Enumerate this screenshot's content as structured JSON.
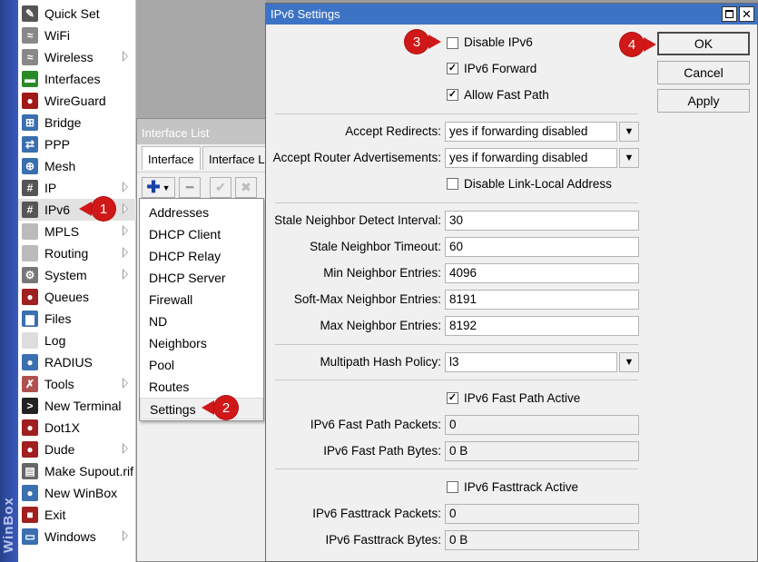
{
  "app_vertical_label": "WinBox",
  "sidebar": {
    "items": [
      {
        "label": "Quick Set",
        "icon": "quick-set-icon",
        "submenu": false
      },
      {
        "label": "WiFi",
        "icon": "wifi-icon",
        "submenu": false
      },
      {
        "label": "Wireless",
        "icon": "wireless-icon",
        "submenu": true
      },
      {
        "label": "Interfaces",
        "icon": "interfaces-icon",
        "submenu": false
      },
      {
        "label": "WireGuard",
        "icon": "wireguard-icon",
        "submenu": false
      },
      {
        "label": "Bridge",
        "icon": "bridge-icon",
        "submenu": false
      },
      {
        "label": "PPP",
        "icon": "ppp-icon",
        "submenu": false
      },
      {
        "label": "Mesh",
        "icon": "mesh-icon",
        "submenu": false
      },
      {
        "label": "IP",
        "icon": "ip-icon",
        "submenu": true
      },
      {
        "label": "IPv6",
        "icon": "ipv6-icon",
        "submenu": true
      },
      {
        "label": "MPLS",
        "icon": "mpls-icon",
        "submenu": true
      },
      {
        "label": "Routing",
        "icon": "routing-icon",
        "submenu": true
      },
      {
        "label": "System",
        "icon": "system-icon",
        "submenu": true
      },
      {
        "label": "Queues",
        "icon": "queues-icon",
        "submenu": false
      },
      {
        "label": "Files",
        "icon": "files-icon",
        "submenu": false
      },
      {
        "label": "Log",
        "icon": "log-icon",
        "submenu": false
      },
      {
        "label": "RADIUS",
        "icon": "radius-icon",
        "submenu": false
      },
      {
        "label": "Tools",
        "icon": "tools-icon",
        "submenu": true
      },
      {
        "label": "New Terminal",
        "icon": "terminal-icon",
        "submenu": false
      },
      {
        "label": "Dot1X",
        "icon": "dot1x-icon",
        "submenu": false
      },
      {
        "label": "Dude",
        "icon": "dude-icon",
        "submenu": true
      },
      {
        "label": "Make Supout.rif",
        "icon": "supout-icon",
        "submenu": false
      },
      {
        "label": "New WinBox",
        "icon": "winbox-icon",
        "submenu": false
      },
      {
        "label": "Exit",
        "icon": "exit-icon",
        "submenu": false
      },
      {
        "label": "Windows",
        "icon": "windows-icon",
        "submenu": true
      }
    ],
    "selected_index": 9
  },
  "interface_list": {
    "title": "Interface List",
    "tabs": [
      "Interface",
      "Interface Li"
    ]
  },
  "ipv6_menu": {
    "items": [
      "Addresses",
      "DHCP Client",
      "DHCP Relay",
      "DHCP Server",
      "Firewall",
      "ND",
      "Neighbors",
      "Pool",
      "Routes",
      "Settings"
    ],
    "selected_index": 9
  },
  "dialog": {
    "title": "IPv6 Settings",
    "disable_ipv6": {
      "label": "Disable IPv6",
      "checked": false
    },
    "ipv6_forward": {
      "label": "IPv6 Forward",
      "checked": true
    },
    "allow_fast_path": {
      "label": "Allow Fast Path",
      "checked": true
    },
    "accept_redirects": {
      "label": "Accept Redirects:",
      "value": "yes if forwarding disabled"
    },
    "accept_router_adv": {
      "label": "Accept Router Advertisements:",
      "value": "yes if forwarding disabled"
    },
    "disable_link_local": {
      "label": "Disable Link-Local Address",
      "checked": false
    },
    "stale_detect": {
      "label": "Stale Neighbor Detect Interval:",
      "value": "30"
    },
    "stale_timeout": {
      "label": "Stale Neighbor Timeout:",
      "value": "60"
    },
    "min_entries": {
      "label": "Min Neighbor Entries:",
      "value": "4096"
    },
    "softmax_entries": {
      "label": "Soft-Max Neighbor Entries:",
      "value": "8191"
    },
    "max_entries": {
      "label": "Max Neighbor Entries:",
      "value": "8192"
    },
    "multipath": {
      "label": "Multipath Hash Policy:",
      "value": "l3"
    },
    "fast_path_active": {
      "label": "IPv6 Fast Path Active",
      "checked": true
    },
    "fast_path_packets": {
      "label": "IPv6 Fast Path Packets:",
      "value": "0"
    },
    "fast_path_bytes": {
      "label": "IPv6 Fast Path Bytes:",
      "value": "0 B"
    },
    "fasttrack_active": {
      "label": "IPv6 Fasttrack Active",
      "checked": false
    },
    "fasttrack_packets": {
      "label": "IPv6 Fasttrack Packets:",
      "value": "0"
    },
    "fasttrack_bytes": {
      "label": "IPv6 Fasttrack Bytes:",
      "value": "0 B"
    },
    "buttons": {
      "ok": "OK",
      "cancel": "Cancel",
      "apply": "Apply"
    }
  },
  "callouts": [
    "1",
    "2",
    "3",
    "4"
  ],
  "colors": {
    "title_bar": "#3d73c4",
    "callout": "#d01818",
    "sidebar_strip": "#27408b"
  }
}
